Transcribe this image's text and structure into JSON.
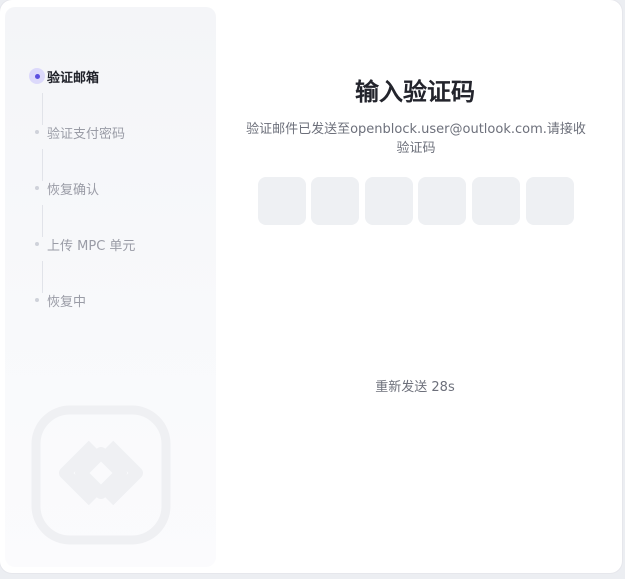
{
  "dialog": {
    "title": "输入验证码",
    "description": "验证邮件已发送至openblock.user@outlook.com.请接收验证码",
    "resend_label": "重新发送 28s"
  },
  "steps": [
    {
      "label": "验证邮箱",
      "active": true
    },
    {
      "label": "验证支付密码",
      "active": false
    },
    {
      "label": "恢复确认",
      "active": false
    },
    {
      "label": "上传 MPC 单元",
      "active": false
    },
    {
      "label": "恢复中",
      "active": false
    }
  ],
  "code_input": {
    "length": 6,
    "values": [
      "",
      "",
      "",
      "",
      "",
      ""
    ]
  },
  "colors": {
    "accent": "#5b4fe0",
    "accent_soft": "#dcd9fb",
    "box_bg": "#eef0f3",
    "sidebar_bg": "#f4f5f8"
  },
  "icons": {
    "watermark": "openblock-logo-icon"
  }
}
